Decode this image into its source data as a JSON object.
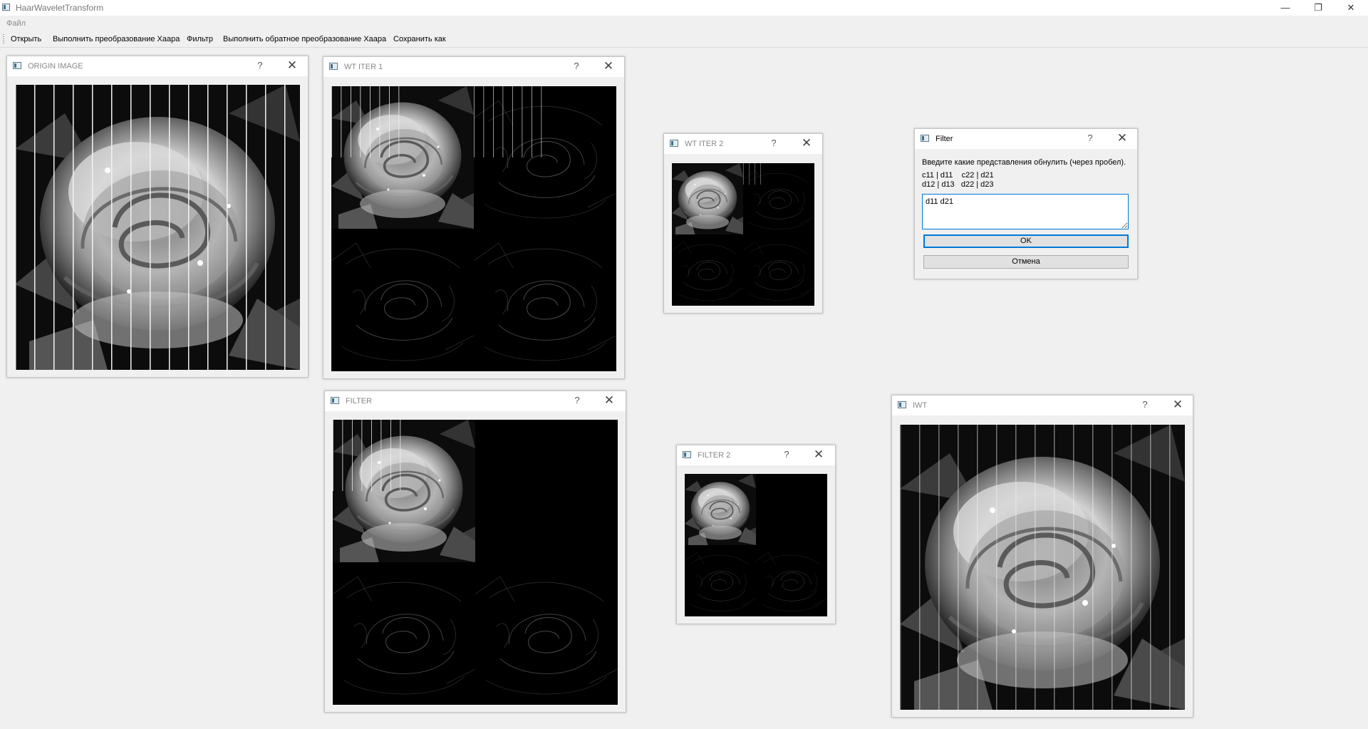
{
  "app": {
    "title": "HaarWaveletTransform",
    "minimize": "—",
    "restore": "❐",
    "close": "✕"
  },
  "menu": {
    "file": "Файл"
  },
  "toolbar": {
    "open": "Открыть",
    "haar": "Выполнить преобразование Хаара",
    "filter": "Фильтр",
    "inverse": "Выполнить обратное преобразование Хаара",
    "save_as": "Сохранить как"
  },
  "windows": {
    "origin": {
      "title": "ORIGIN IMAGE",
      "help": "?",
      "close": "✕"
    },
    "wt1": {
      "title": "WT ITER 1",
      "help": "?",
      "close": "✕"
    },
    "wt2": {
      "title": "WT ITER 2",
      "help": "?",
      "close": "✕"
    },
    "filter": {
      "title": "FILTER",
      "help": "?",
      "close": "✕"
    },
    "filter2": {
      "title": "FILTER 2",
      "help": "?",
      "close": "✕"
    },
    "iwt": {
      "title": "IWT",
      "help": "?",
      "close": "✕"
    }
  },
  "dialog": {
    "title": "Filter",
    "help": "?",
    "close": "✕",
    "prompt": "Введите какие представления обнулить (через пробел).",
    "legend_line1": "c11 | d11    c22 | d21",
    "legend_line2": "d12 | d13   d22 | d23",
    "input_value": "d11 d21",
    "ok": "OK",
    "cancel": "Отмена"
  },
  "icons": {
    "app": "window-app-icon",
    "subwindow": "window-app-icon",
    "help": "question-mark-icon",
    "close": "close-icon"
  },
  "colors": {
    "background": "#f0f0f0",
    "titlebar": "#ffffff",
    "focus_accent": "#0078d7",
    "image_black": "#000000"
  }
}
